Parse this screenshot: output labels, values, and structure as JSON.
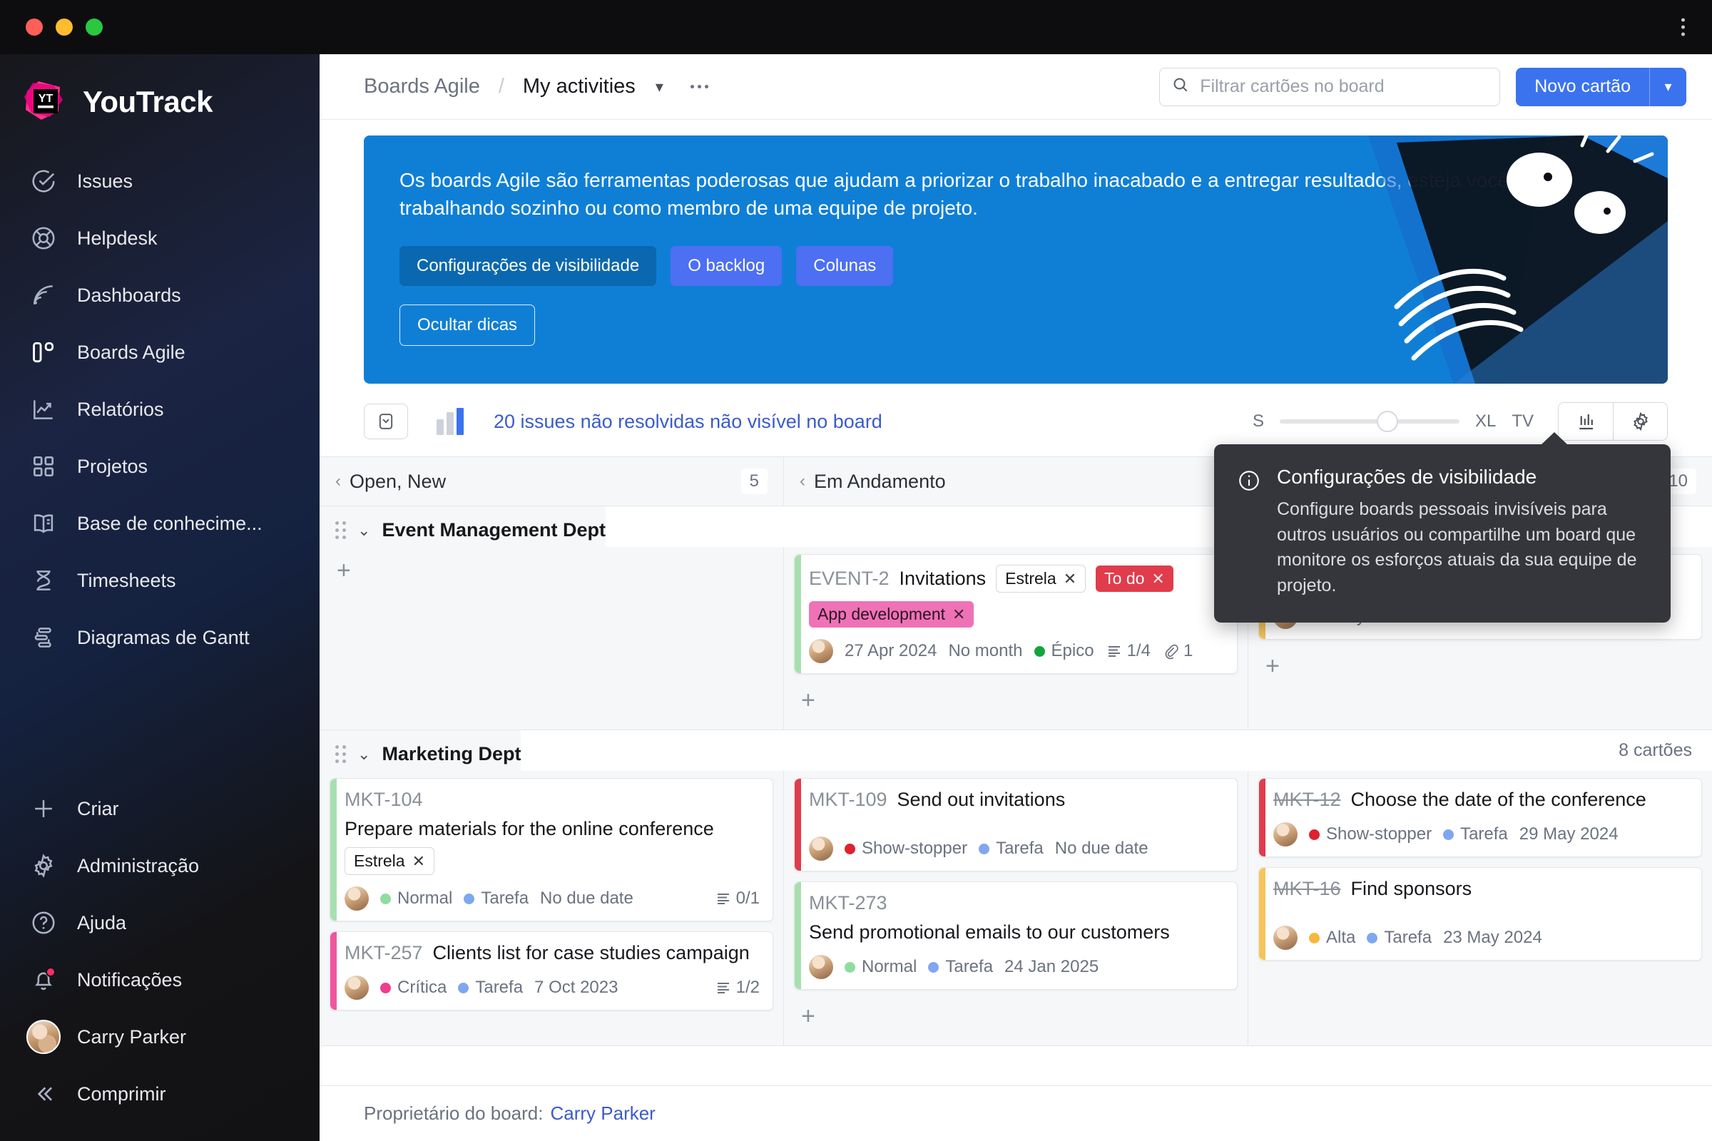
{
  "window": {
    "traffic_lights": [
      "close",
      "minimize",
      "maximize"
    ],
    "menu_icon": "kebab-vertical-icon"
  },
  "sidebar": {
    "brand": "YouTrack",
    "items": [
      {
        "label": "Issues",
        "icon": "check-circle-icon"
      },
      {
        "label": "Helpdesk",
        "icon": "lifebuoy-icon"
      },
      {
        "label": "Dashboards",
        "icon": "radar-icon"
      },
      {
        "label": "Boards Agile",
        "icon": "board-columns-icon",
        "active": true
      },
      {
        "label": "Relatórios",
        "icon": "chart-trend-icon"
      },
      {
        "label": "Projetos",
        "icon": "grid-squares-icon"
      },
      {
        "label": "Base de conhecime...",
        "icon": "book-icon"
      },
      {
        "label": "Timesheets",
        "icon": "hourglass-icon"
      },
      {
        "label": "Diagramas de Gantt",
        "icon": "gantt-icon"
      }
    ],
    "bottom_items": [
      {
        "label": "Criar",
        "icon": "plus-icon"
      },
      {
        "label": "Administração",
        "icon": "gear-icon"
      },
      {
        "label": "Ajuda",
        "icon": "question-circle-icon"
      },
      {
        "label": "Notificações",
        "icon": "bell-icon",
        "badge": true
      }
    ],
    "user": {
      "name": "Carry Parker",
      "avatar": "user-avatar"
    },
    "collapse": {
      "label": "Comprimir",
      "icon": "chevrons-left-icon"
    }
  },
  "topbar": {
    "breadcrumb_root": "Boards Agile",
    "breadcrumb_sep": "/",
    "breadcrumb_current": "My activities",
    "chevron": "▾",
    "more": "more-options-icon",
    "search": {
      "placeholder": "Filtrar cartões no board",
      "value": "",
      "icon": "search-icon"
    },
    "new_card_label": "Novo cartão",
    "new_card_caret": "▾"
  },
  "banner": {
    "text": "Os boards Agile são ferramentas poderosas que ajudam a priorizar o trabalho inacabado e a entregar resultados, esteja você trabalhando sozinho ou como membro de uma equipe de projeto.",
    "chips": [
      {
        "label": "Configurações de visibilidade",
        "style": "dark"
      },
      {
        "label": "O backlog",
        "style": "light"
      },
      {
        "label": "Colunas",
        "style": "light"
      }
    ],
    "hide_label": "Ocultar dicas",
    "bg_color": "#0f7fd6"
  },
  "toolbar": {
    "inbox_icon": "card-collapse-icon",
    "chart_icon": "bar-chart-icon",
    "unresolved_text": "20 issues não resolvidas não visível no board",
    "scale_min": "S",
    "scale_max": "XL",
    "tv_label": "TV",
    "slider_value": 55,
    "chart_button": "chart-icon",
    "settings_button": "gear-icon"
  },
  "board": {
    "columns": [
      {
        "name": "Open, New",
        "count": "5"
      },
      {
        "name": "Em Andamento",
        "count": ""
      },
      {
        "name": "",
        "count": "10"
      }
    ],
    "swimlanes": [
      {
        "title": "Event Management Dept",
        "count": "",
        "columns": [
          {
            "cards": [],
            "add": "+"
          },
          {
            "cards": [
              {
                "id": "EVENT-2",
                "title": "Invitations",
                "stripe": "#a7e0ae",
                "tags": [
                  {
                    "label": "Estrela",
                    "style": "outline",
                    "x": "✕"
                  },
                  {
                    "label": "To do",
                    "style": "red",
                    "x": "✕"
                  }
                ],
                "tags2": [
                  {
                    "label": "App development",
                    "style": "pink",
                    "x": "✕"
                  }
                ],
                "meta": [
                  {
                    "type": "date",
                    "text": "27 Apr 2024"
                  },
                  {
                    "type": "text",
                    "text": "No month"
                  },
                  {
                    "type": "dot",
                    "text": "Épico",
                    "color": "#13a53d"
                  },
                  {
                    "type": "progress",
                    "text": "1/4"
                  },
                  {
                    "type": "attach",
                    "text": "1"
                  }
                ]
              }
            ],
            "add": "+"
          },
          {
            "cards": [
              {
                "id": "",
                "title": "",
                "stripe": "#f7c45a",
                "tags": [],
                "tags2": [],
                "meta": [
                  {
                    "type": "date",
                    "text": "28 May 2024"
                  },
                  {
                    "type": "text",
                    "text": "No month"
                  },
                  {
                    "type": "dot",
                    "text": "Tarefa",
                    "color": "#7fa7f0"
                  }
                ]
              }
            ],
            "add": "+"
          }
        ]
      },
      {
        "title": "Marketing Dept",
        "count": "8 cartões",
        "columns": [
          {
            "cards": [
              {
                "id": "MKT-104",
                "title": "Prepare materials for the online conference",
                "stripe": "#a7e0ae",
                "tags": [
                  {
                    "label": "Estrela",
                    "style": "outline",
                    "x": "✕"
                  }
                ],
                "tags2": [],
                "meta": [
                  {
                    "type": "dot",
                    "text": "Normal",
                    "color": "#8fdca0"
                  },
                  {
                    "type": "dot",
                    "text": "Tarefa",
                    "color": "#7fa7f0"
                  },
                  {
                    "type": "text",
                    "text": "No due date"
                  },
                  {
                    "type": "progress",
                    "text": "0/1"
                  }
                ]
              },
              {
                "id": "MKT-257",
                "title": "Clients list for case studies campaign",
                "stripe": "#f0569f",
                "tags": [],
                "tags2": [],
                "meta": [
                  {
                    "type": "dot",
                    "text": "Crítica",
                    "color": "#ef3d8c"
                  },
                  {
                    "type": "dot",
                    "text": "Tarefa",
                    "color": "#7fa7f0"
                  },
                  {
                    "type": "text",
                    "text": "7 Oct 2023"
                  },
                  {
                    "type": "progress",
                    "text": "1/2"
                  }
                ]
              }
            ],
            "add": ""
          },
          {
            "cards": [
              {
                "id": "MKT-109",
                "title": "Send out invitations",
                "stripe": "#e03c4c",
                "tags": [],
                "tags2": [],
                "meta": [
                  {
                    "type": "dot",
                    "text": "Show-stopper",
                    "color": "#e02030"
                  },
                  {
                    "type": "dot",
                    "text": "Tarefa",
                    "color": "#7fa7f0"
                  },
                  {
                    "type": "text",
                    "text": "No due date"
                  }
                ]
              },
              {
                "id": "MKT-273",
                "title": "Send promotional emails to our customers",
                "stripe": "#a7e0ae",
                "tags": [],
                "tags2": [],
                "meta": [
                  {
                    "type": "dot",
                    "text": "Normal",
                    "color": "#8fdca0"
                  },
                  {
                    "type": "dot",
                    "text": "Tarefa",
                    "color": "#7fa7f0"
                  },
                  {
                    "type": "text",
                    "text": "24 Jan 2025"
                  }
                ]
              }
            ],
            "add": "+"
          },
          {
            "cards": [
              {
                "id": "MKT-12",
                "id_done": true,
                "title": "Choose the date of the conference",
                "stripe": "#e03c4c",
                "tags": [],
                "tags2": [],
                "meta": [
                  {
                    "type": "dot",
                    "text": "Show-stopper",
                    "color": "#e02030"
                  },
                  {
                    "type": "dot",
                    "text": "Tarefa",
                    "color": "#7fa7f0"
                  },
                  {
                    "type": "text",
                    "text": "29 May 2024"
                  }
                ]
              },
              {
                "id": "MKT-16",
                "id_done": true,
                "title": "Find sponsors",
                "stripe": "#f7c45a",
                "tags": [],
                "tags2": [],
                "meta": [
                  {
                    "type": "dot",
                    "text": "Alta",
                    "color": "#f5b73c"
                  },
                  {
                    "type": "dot",
                    "text": "Tarefa",
                    "color": "#7fa7f0"
                  },
                  {
                    "type": "text",
                    "text": "23 May 2024"
                  }
                ]
              }
            ],
            "add": ""
          }
        ]
      }
    ]
  },
  "tooltip": {
    "icon": "info-circle-icon",
    "title": "Configurações de visibilidade",
    "body": "Configure boards pessoais invisíveis para outros usuários ou compartilhe um board que monitore os esforços atuais da sua equipe de projeto."
  },
  "footer": {
    "label": "Proprietário do board:",
    "owner": "Carry Parker"
  },
  "colors": {
    "accent": "#3b73ef",
    "banner": "#0f7fd6",
    "link": "#3b5bcc",
    "sidebar_bg": "#141418"
  }
}
